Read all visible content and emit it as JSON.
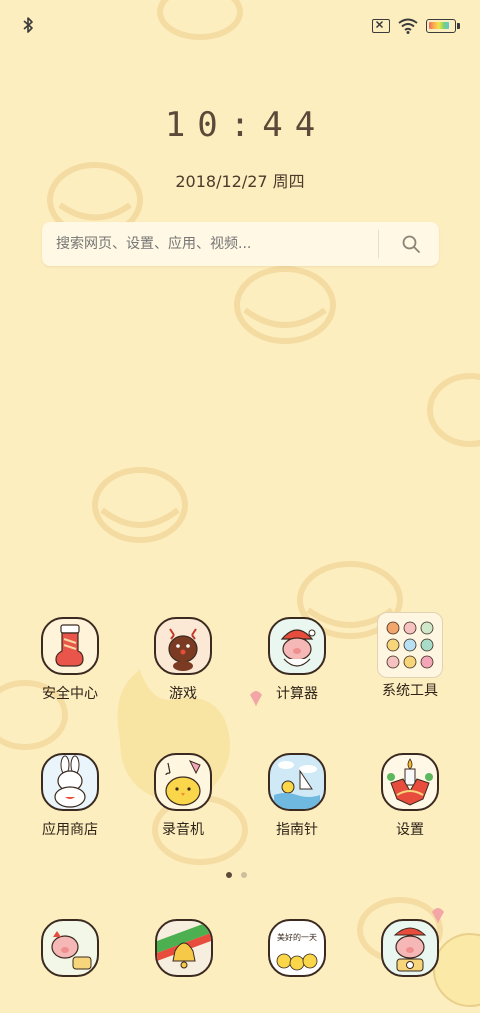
{
  "status_bar": {
    "left_icons": [
      "bluetooth-icon"
    ],
    "right_icons": [
      "no-sim-icon",
      "wifi-icon",
      "battery-icon"
    ],
    "battery_level": 0.85
  },
  "clock": {
    "time": "10:44",
    "date": "2018/12/27 周四"
  },
  "search": {
    "placeholder": "搜索网页、设置、应用、视频...",
    "icon": "search-icon"
  },
  "apps_row1": [
    {
      "label": "安全中心",
      "icon": "christmas-stocking-icon"
    },
    {
      "label": "游戏",
      "icon": "reindeer-icon"
    },
    {
      "label": "计算器",
      "icon": "santa-pig-icon"
    },
    {
      "label": "系统工具",
      "icon": "folder-icon"
    }
  ],
  "apps_row2": [
    {
      "label": "应用商店",
      "icon": "bunny-chick-icon"
    },
    {
      "label": "录音机",
      "icon": "chick-music-icon"
    },
    {
      "label": "指南针",
      "icon": "chicks-boat-icon"
    },
    {
      "label": "设置",
      "icon": "christmas-candle-icon"
    }
  ],
  "page_indicator": {
    "pages": 2,
    "current": 1
  },
  "dock": {
    "icons": [
      "pig-phone-icon",
      "christmas-bell-icon",
      "beautiful-day-icon",
      "pig-camera-icon"
    ],
    "beautiful_day_text": "美好的一天"
  },
  "colors": {
    "background": "#fdeec0",
    "icon_border": "#3a2a1f",
    "text": "#2e2418"
  }
}
